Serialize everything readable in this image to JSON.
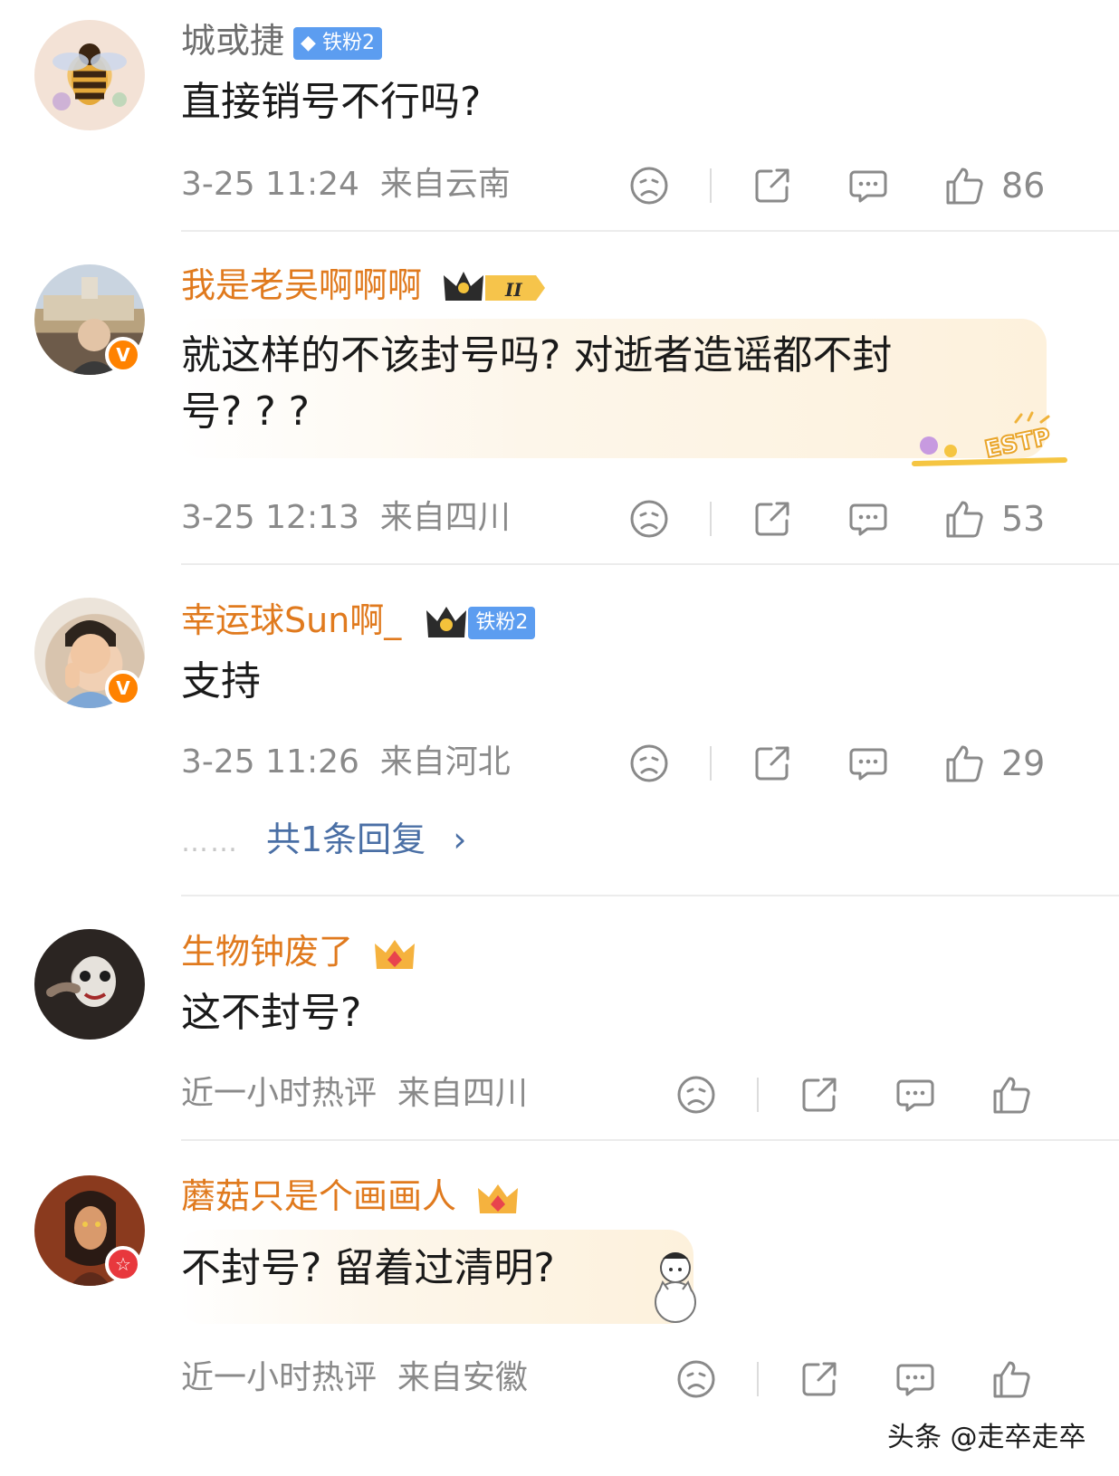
{
  "comments": [
    {
      "username": "城或捷",
      "badge": "铁粉2",
      "text": "直接销号不行吗?",
      "time": "3-25 11:24",
      "location": "来自云南",
      "likes": "86"
    },
    {
      "username": "我是老吴啊啊啊",
      "crown_level": "II",
      "text_line1": "就这样的不该封号吗? 对逝者造谣都不封",
      "text_line2": "号? ? ?",
      "decor": "ESTP",
      "time": "3-25 12:13",
      "location": "来自四川",
      "likes": "53",
      "verified": "V"
    },
    {
      "username": "幸运球Sun啊_",
      "badge": "铁粉2",
      "text": "支持",
      "time": "3-25 11:26",
      "location": "来自河北",
      "likes": "29",
      "verified": "V",
      "reply_dots": "……",
      "reply_link": "共1条回复",
      "reply_arrow": "›"
    },
    {
      "username": "生物钟废了",
      "text": "这不封号?",
      "time": "近一小时热评",
      "location": "来自四川"
    },
    {
      "username": "蘑菇只是个画画人",
      "text": "不封号? 留着过清明?",
      "time": "近一小时热评",
      "location": "来自安徽"
    }
  ],
  "watermark": "头条 @走卒走卒",
  "colors": {
    "orange_name": "#e07a1e",
    "reply_link": "#4a6fa5",
    "fan_badge": "#5c9df0",
    "verified": "#ff8200"
  },
  "icons": [
    "sad-face-icon",
    "share-icon",
    "comment-icon",
    "thumbs-up-icon"
  ]
}
